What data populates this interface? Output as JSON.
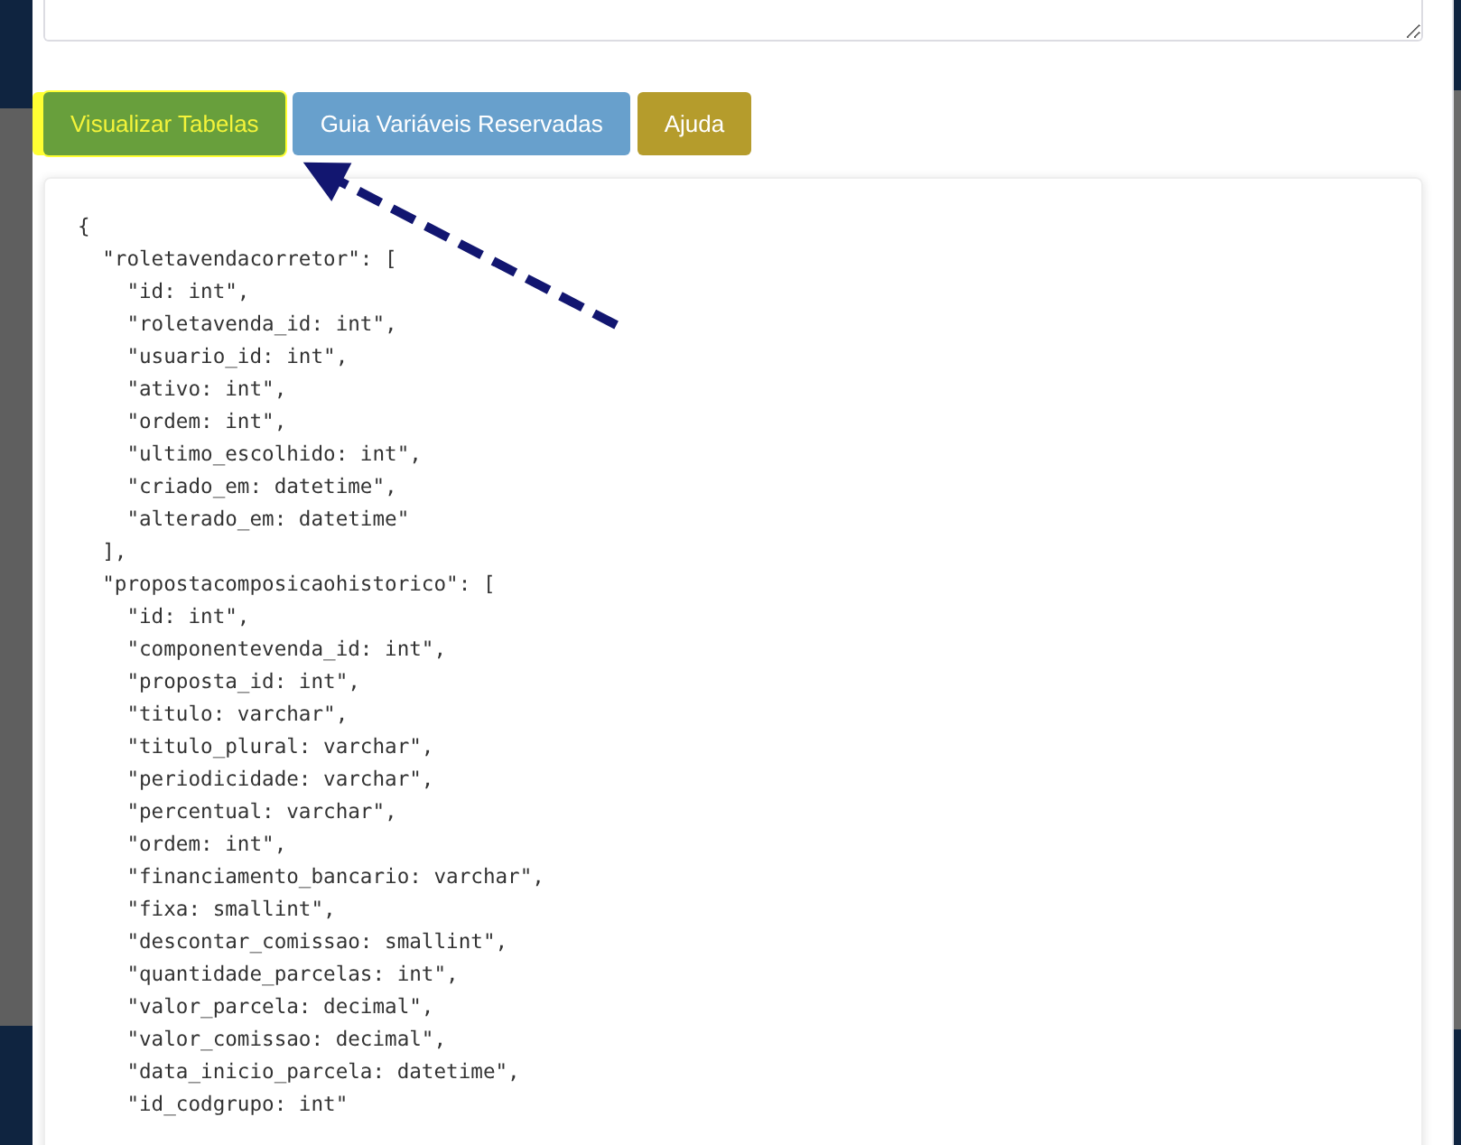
{
  "textarea": {
    "resizable": true
  },
  "buttons": [
    {
      "label": "Visualizar Tabelas",
      "color": "#689f3c",
      "highlighted": true
    },
    {
      "label": "Guia Variáveis Reservadas",
      "color": "#68a0cc",
      "highlighted": false
    },
    {
      "label": "Ajuda",
      "color": "#b59c2c",
      "highlighted": false
    }
  ],
  "code_lines": [
    "{",
    "  \"roletavendacorretor\": [",
    "    \"id: int\",",
    "    \"roletavenda_id: int\",",
    "    \"usuario_id: int\",",
    "    \"ativo: int\",",
    "    \"ordem: int\",",
    "    \"ultimo_escolhido: int\",",
    "    \"criado_em: datetime\",",
    "    \"alterado_em: datetime\"",
    "  ],",
    "  \"propostacomposicaohistorico\": [",
    "    \"id: int\",",
    "    \"componentevenda_id: int\",",
    "    \"proposta_id: int\",",
    "    \"titulo: varchar\",",
    "    \"titulo_plural: varchar\",",
    "    \"periodicidade: varchar\",",
    "    \"percentual: varchar\",",
    "    \"ordem: int\",",
    "    \"financiamento_bancario: varchar\",",
    "    \"fixa: smallint\",",
    "    \"descontar_comissao: smallint\",",
    "    \"quantidade_parcelas: int\",",
    "    \"valor_parcela: decimal\",",
    "    \"valor_comissao: decimal\",",
    "    \"data_inicio_parcela: datetime\",",
    "    \"id_codgrupo: int\""
  ]
}
